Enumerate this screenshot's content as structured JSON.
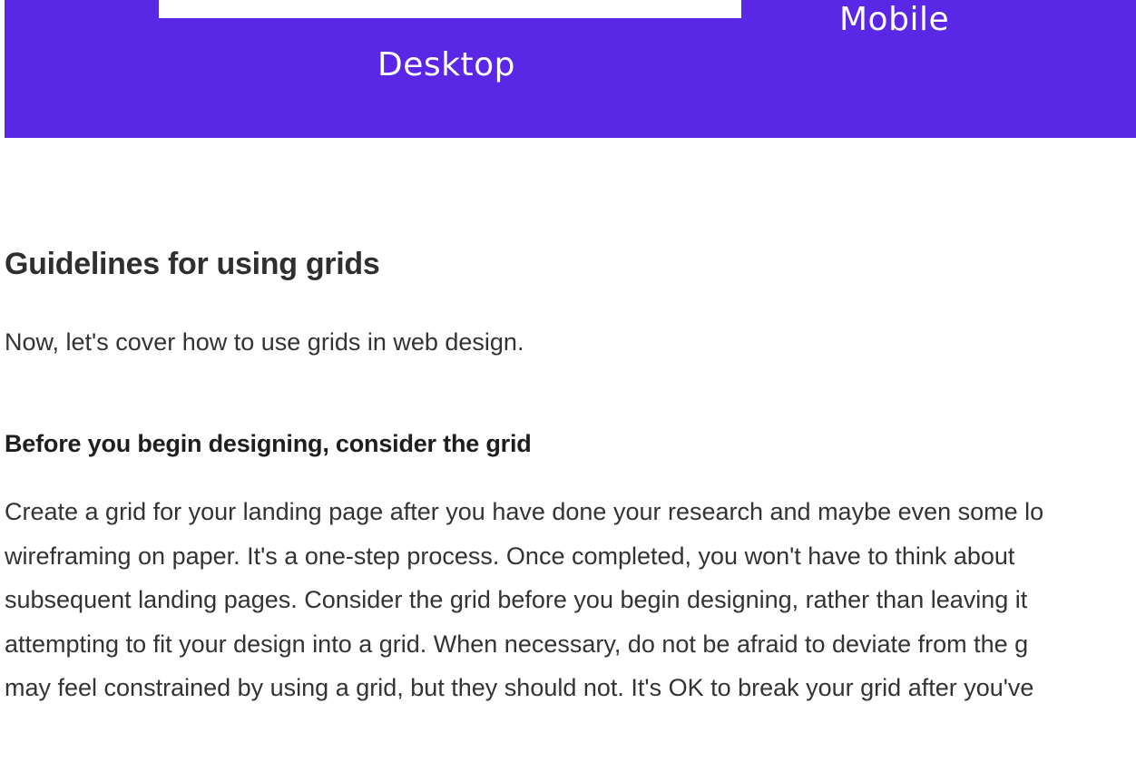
{
  "hero": {
    "desktop_label": "Desktop",
    "mobile_label": "Mobile",
    "background_color": "#5b27e6"
  },
  "article": {
    "section_title": "Guidelines for using grids",
    "intro": "Now, let's cover how to use grids in web design.",
    "subheading": "Before you begin designing, consider the grid",
    "paragraph_lines": [
      "Create a grid for your landing page after you have done your research and maybe even some lo",
      "wireframing on paper. It's a one-step process. Once completed, you won't have to think about",
      "subsequent landing pages. Consider the grid before you begin designing, rather than leaving it",
      "attempting to fit your design into a grid. When necessary, do not be afraid to deviate from the g",
      "may feel constrained by using a grid, but they should not. It's OK to break your grid after you've"
    ]
  }
}
